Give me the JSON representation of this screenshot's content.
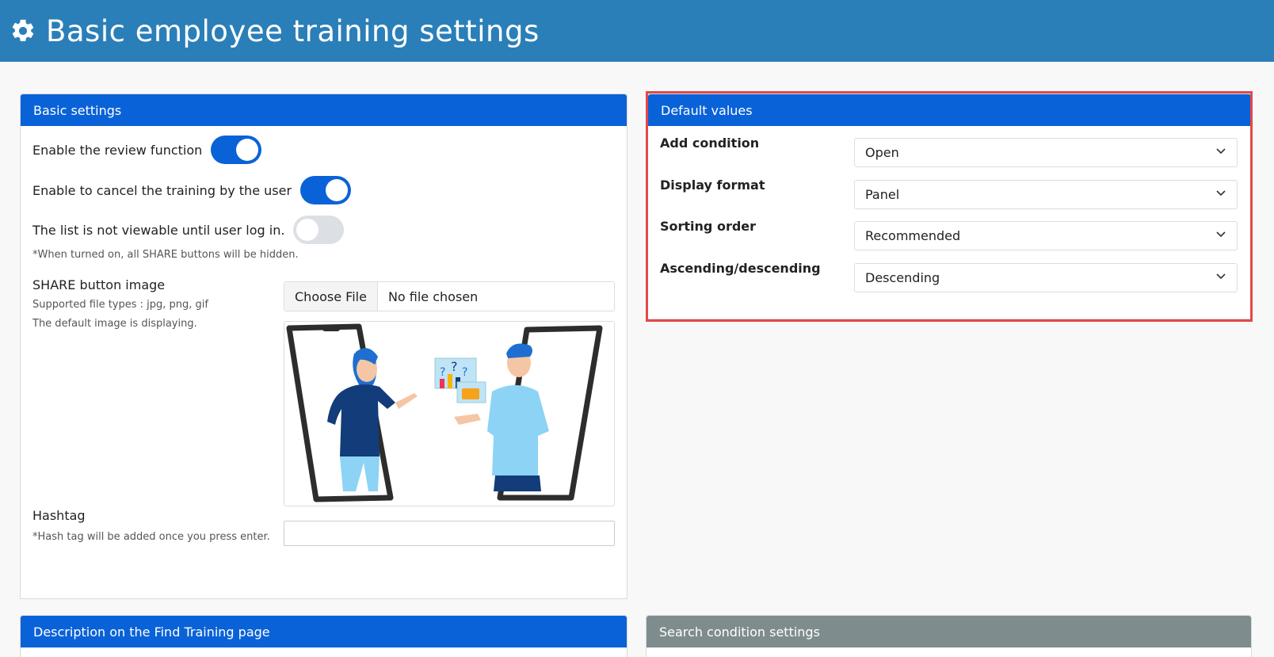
{
  "header": {
    "title": "Basic employee training settings",
    "icon": "gear-icon"
  },
  "basic_settings": {
    "title": "Basic settings",
    "review_label": "Enable the review function",
    "review_on": true,
    "cancel_label": "Enable to cancel the training by the user",
    "cancel_on": true,
    "login_label": "The list is not viewable until user log in.",
    "login_on": false,
    "login_note": "*When turned on, all SHARE buttons will be hidden.",
    "share_label": "SHARE button image",
    "share_types": "Supported file types : jpg, png, gif",
    "share_default": "The default image is displaying.",
    "choose_file": "Choose File",
    "no_file": "No file chosen",
    "hashtag_label": "Hashtag",
    "hashtag_note": "*Hash tag will be added once you press enter.",
    "hashtag_value": ""
  },
  "default_values": {
    "title": "Default values",
    "rows": [
      {
        "label": "Add condition",
        "value": "Open"
      },
      {
        "label": "Display format",
        "value": "Panel"
      },
      {
        "label": "Sorting order",
        "value": "Recommended"
      },
      {
        "label": "Ascending/descending",
        "value": "Descending"
      }
    ]
  },
  "description_panel": {
    "title": "Description on the Find Training page"
  },
  "search_panel": {
    "title": "Search condition settings"
  },
  "colors": {
    "header": "#2b7fb8",
    "panel_head": "#0a62d8",
    "panel_head_gray": "#7f8c8d",
    "highlight": "#e34848"
  }
}
